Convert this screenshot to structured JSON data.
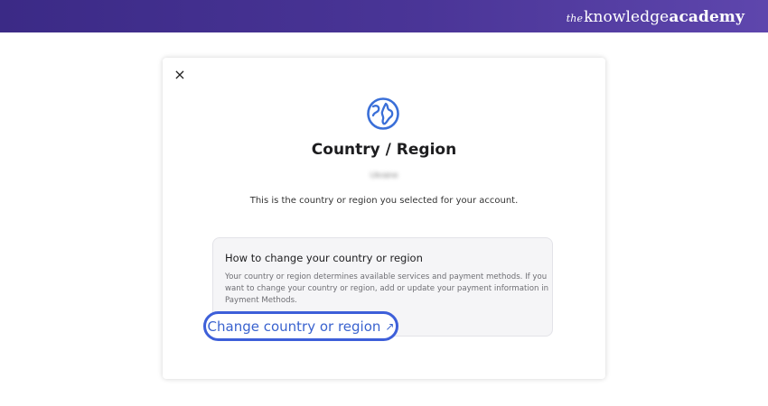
{
  "banner": {
    "brand_prefix": "the",
    "brand_word1": "knowledge",
    "brand_word2": "academy"
  },
  "dialog": {
    "close_label": "×",
    "icon": "globe-icon",
    "title": "Country / Region",
    "current_country": "Ukraine",
    "subtitle": "This is the country or region you selected for your account.",
    "info": {
      "heading": "How to change your country or region",
      "body": "Your country or region determines available services and payment methods. If you want to change your country or region, add or update your payment information in Payment Methods."
    },
    "link": {
      "label": "Change country or region",
      "arrow": "↗"
    }
  },
  "colors": {
    "banner_start": "#3b2a86",
    "banner_end": "#5e46ad",
    "accent_blue": "#3a63cf",
    "highlight_outline": "#3d5fd9"
  }
}
